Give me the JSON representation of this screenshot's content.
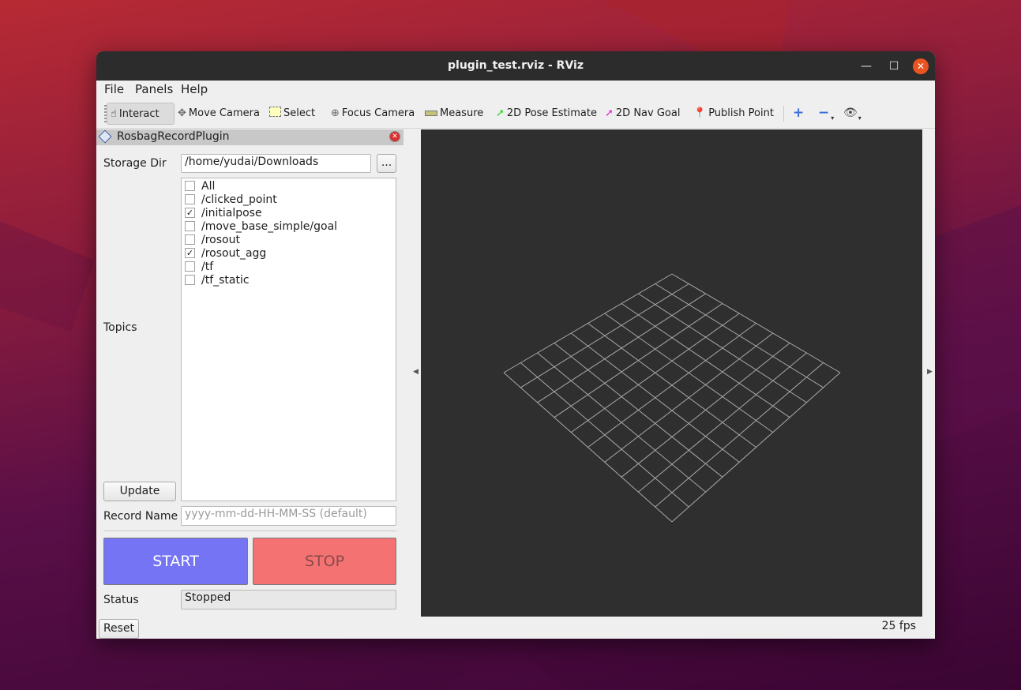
{
  "window": {
    "title": "plugin_test.rviz - RViz",
    "minimize": "—",
    "maximize": "☐",
    "close": "✕"
  },
  "menubar": {
    "items": [
      "File",
      "Panels",
      "Help"
    ]
  },
  "toolbar": {
    "tools": [
      {
        "label": "Interact",
        "icon": "hand-pointer-icon",
        "active": true
      },
      {
        "label": "Move Camera",
        "icon": "move-camera-icon"
      },
      {
        "label": "Select",
        "icon": "select-box-icon"
      },
      {
        "label": "Focus Camera",
        "icon": "focus-camera-icon"
      },
      {
        "label": "Measure",
        "icon": "ruler-icon"
      },
      {
        "label": "2D Pose Estimate",
        "icon": "green-arrow-icon"
      },
      {
        "label": "2D Nav Goal",
        "icon": "magenta-arrow-icon"
      },
      {
        "label": "Publish Point",
        "icon": "map-pin-icon"
      }
    ],
    "extra_icons": [
      "plus-icon",
      "minus-icon",
      "eye-icon"
    ]
  },
  "panel": {
    "title": "RosbagRecordPlugin",
    "storage_dir_label": "Storage Dir",
    "storage_dir_value": "/home/yudai/Downloads",
    "browse_label": "...",
    "topics_label": "Topics",
    "topics": [
      {
        "name": "All",
        "checked": false
      },
      {
        "name": "/clicked_point",
        "checked": false
      },
      {
        "name": "/initialpose",
        "checked": true
      },
      {
        "name": "/move_base_simple/goal",
        "checked": false
      },
      {
        "name": "/rosout",
        "checked": false
      },
      {
        "name": "/rosout_agg",
        "checked": true
      },
      {
        "name": "/tf",
        "checked": false
      },
      {
        "name": "/tf_static",
        "checked": false
      }
    ],
    "update_label": "Update",
    "record_name_label": "Record Name",
    "record_name_placeholder": "yyyy-mm-dd-HH-MM-SS (default)",
    "start_label": "START",
    "stop_label": "STOP",
    "status_label": "Status",
    "status_value": "Stopped",
    "reset_label": "Reset"
  },
  "viewport": {
    "fps": "25 fps",
    "background": "#2f2f2f",
    "grid_color": "#a8a8a8"
  },
  "colors": {
    "start": "#7474f4",
    "stop": "#f47272",
    "close": "#e95420"
  }
}
